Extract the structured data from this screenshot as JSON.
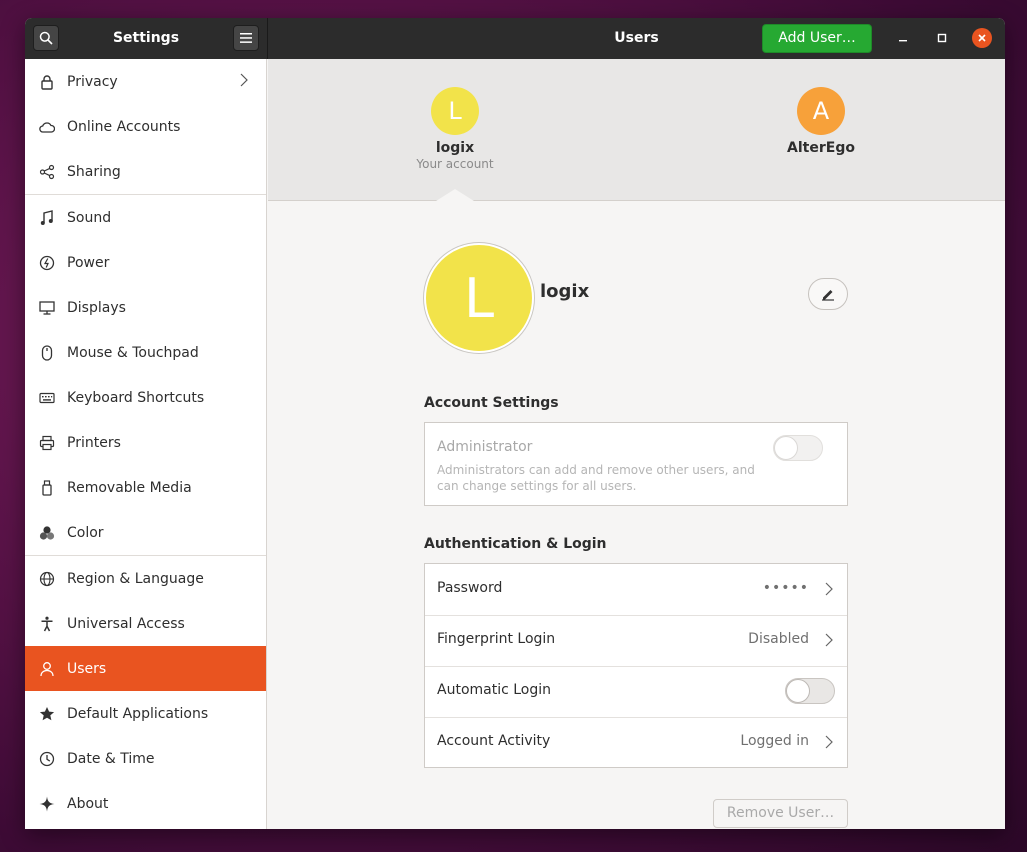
{
  "titlebar": {
    "sidebar_title": "Settings",
    "main_title": "Users",
    "add_user_label": "Add User…"
  },
  "sidebar": {
    "items": [
      {
        "label": "Privacy",
        "icon": "lock-icon"
      },
      {
        "label": "Online Accounts",
        "icon": "cloud-icon"
      },
      {
        "label": "Sharing",
        "icon": "share-icon"
      },
      {
        "label": "Sound",
        "icon": "music-note-icon"
      },
      {
        "label": "Power",
        "icon": "power-icon"
      },
      {
        "label": "Displays",
        "icon": "display-icon"
      },
      {
        "label": "Mouse & Touchpad",
        "icon": "mouse-icon"
      },
      {
        "label": "Keyboard Shortcuts",
        "icon": "keyboard-icon"
      },
      {
        "label": "Printers",
        "icon": "printer-icon"
      },
      {
        "label": "Removable Media",
        "icon": "usb-icon"
      },
      {
        "label": "Color",
        "icon": "color-icon"
      },
      {
        "label": "Region & Language",
        "icon": "globe-icon"
      },
      {
        "label": "Universal Access",
        "icon": "accessibility-icon"
      },
      {
        "label": "Users",
        "icon": "user-icon"
      },
      {
        "label": "Default Applications",
        "icon": "star-icon"
      },
      {
        "label": "Date & Time",
        "icon": "clock-icon"
      },
      {
        "label": "About",
        "icon": "sparkle-icon"
      }
    ],
    "active": "Users"
  },
  "users": [
    {
      "initial": "L",
      "name": "logix",
      "subtitle": "Your account",
      "color": "#f2e34a"
    },
    {
      "initial": "A",
      "name": "AlterEgo",
      "subtitle": "",
      "color": "#f7a13a"
    }
  ],
  "profile": {
    "initial": "L",
    "name": "logix"
  },
  "account_settings": {
    "title": "Account Settings",
    "admin_label": "Administrator",
    "admin_desc": "Administrators can add and remove other users, and can change settings for all users.",
    "admin_enabled": false
  },
  "auth": {
    "title": "Authentication & Login",
    "rows": [
      {
        "label": "Password",
        "value": "•••••"
      },
      {
        "label": "Fingerprint Login",
        "value": "Disabled"
      },
      {
        "label": "Automatic Login",
        "value": ""
      },
      {
        "label": "Account Activity",
        "value": "Logged in"
      }
    ],
    "automatic_login_enabled": false
  },
  "remove_user_label": "Remove User…",
  "colors": {
    "accent": "#e95420",
    "add_button": "#26a932",
    "titlebar": "#2c2c2c"
  }
}
